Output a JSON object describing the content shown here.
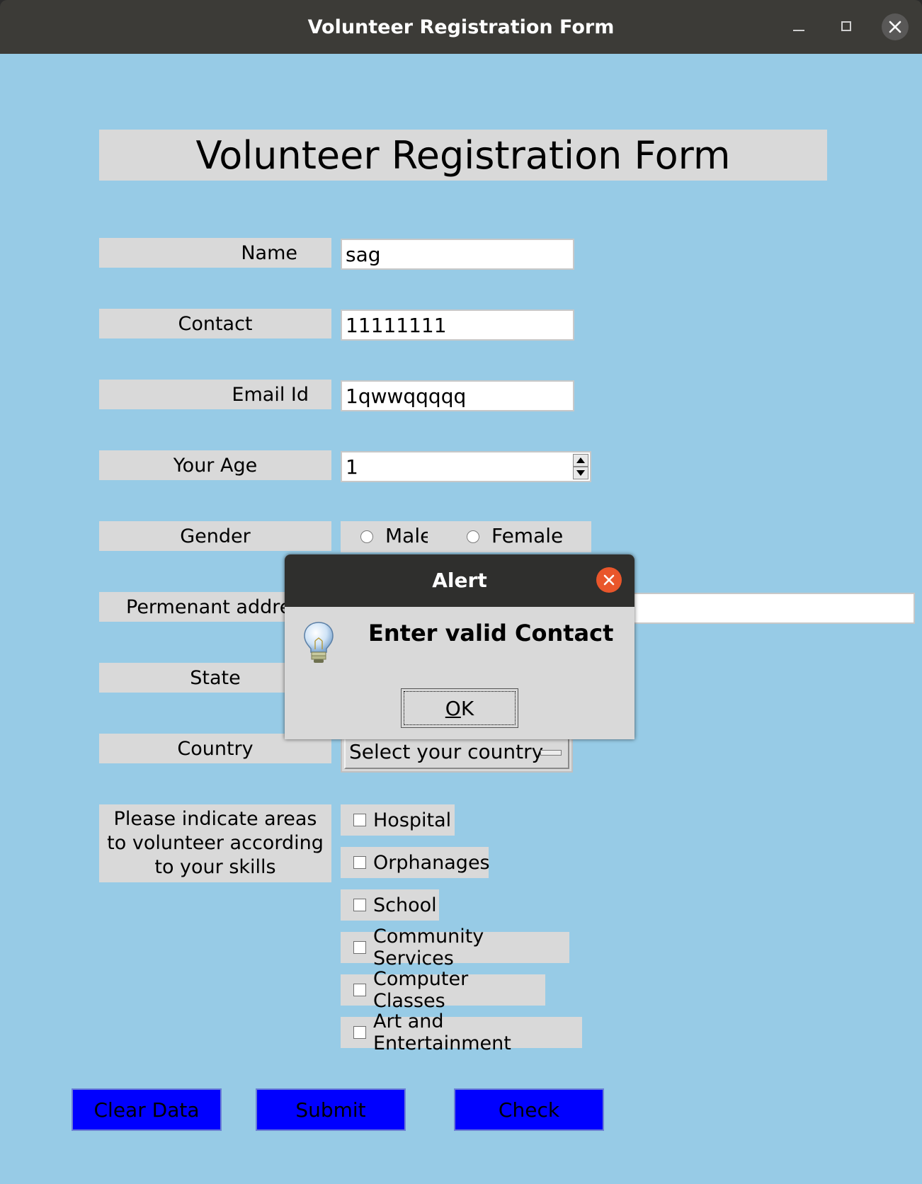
{
  "window": {
    "title": "Volunteer Registration Form"
  },
  "form": {
    "heading": "Volunteer Registration Form",
    "name_label": "Name",
    "name_value": "sag",
    "contact_label": "Contact",
    "contact_value": "11111111",
    "email_label": "Email Id",
    "email_value": "1qwwqqqqq",
    "age_label": "Your Age",
    "age_value": "1",
    "gender_label": "Gender",
    "gender_options": [
      "Male",
      "Female"
    ],
    "address_label": "Permenant address",
    "address_value": "",
    "state_label": "State",
    "country_label": "Country",
    "country_selected": "Select your country",
    "areas_label": "Please indicate areas to volunteer according to your skills",
    "areas": [
      "Hospital",
      "Orphanages",
      "School",
      "Community Services",
      "Computer Classes",
      "Art and Entertainment"
    ],
    "buttons": {
      "clear": "Clear Data",
      "submit": "Submit",
      "check": "Check"
    }
  },
  "alert": {
    "title": "Alert",
    "message": "Enter valid Contact",
    "ok_label": "OK",
    "icon": "lightbulb-icon"
  },
  "colors": {
    "background": "#97cbe6",
    "label_bg": "#d9d9d9",
    "button_blue": "#0000ff",
    "titlebar": "#3c3b37",
    "close_orange": "#e9562b"
  }
}
